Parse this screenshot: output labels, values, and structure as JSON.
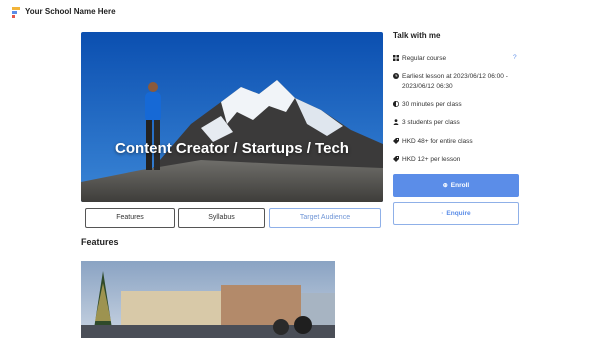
{
  "header": {
    "school_name": "Your School Name Here"
  },
  "hero": {
    "title": "Content Creator / Startups / Tech"
  },
  "tabs": [
    {
      "label": "Features"
    },
    {
      "label": "Syllabus"
    },
    {
      "label": "Target Audience"
    }
  ],
  "main": {
    "section_heading": "Features"
  },
  "sidebar": {
    "title": "Talk with me",
    "help": "?",
    "items": [
      {
        "icon": "grid-icon",
        "label": "Regular course"
      },
      {
        "icon": "clock-icon",
        "label": "Earliest lesson at 2023/06/12 06:00 - 2023/06/12 06:30"
      },
      {
        "icon": "half-circle-icon",
        "label": "30 minutes per class"
      },
      {
        "icon": "person-icon",
        "label": "3 students per class"
      },
      {
        "icon": "tag-icon",
        "label": "HKD 48+ for entire class"
      },
      {
        "icon": "tag-icon",
        "label": "HKD 12+ per lesson"
      }
    ],
    "enroll_label": "Enroll",
    "enquire_label": "Enquire"
  },
  "colors": {
    "accent": "#5b8de8",
    "accent_light": "#8fb0e8"
  }
}
